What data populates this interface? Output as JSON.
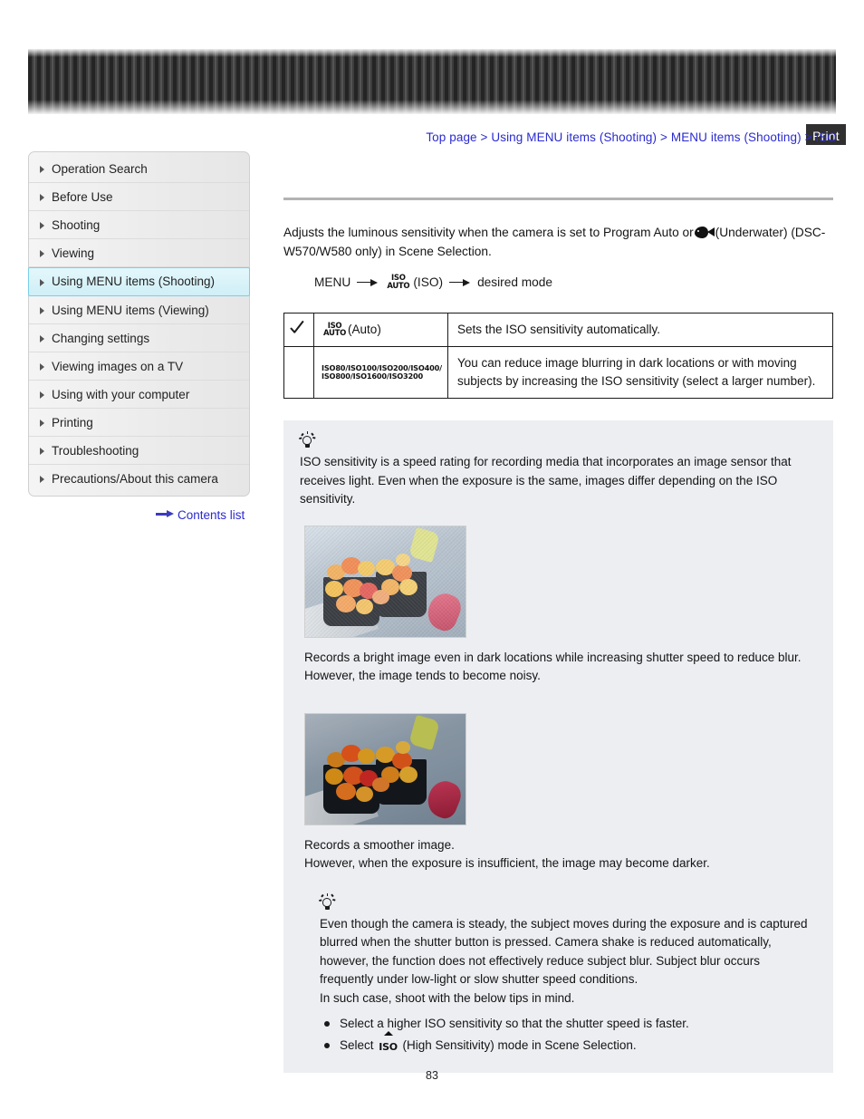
{
  "header": {
    "print_label": "Print"
  },
  "breadcrumb": {
    "items": [
      "Top page",
      "Using MENU items (Shooting)",
      "MENU items (Shooting)",
      "ISO"
    ],
    "separator": ">"
  },
  "sidebar": {
    "items": [
      {
        "label": "Operation Search",
        "active": false
      },
      {
        "label": "Before Use",
        "active": false
      },
      {
        "label": "Shooting",
        "active": false
      },
      {
        "label": "Viewing",
        "active": false
      },
      {
        "label": "Using MENU items (Shooting)",
        "active": true
      },
      {
        "label": "Using MENU items (Viewing)",
        "active": false
      },
      {
        "label": "Changing settings",
        "active": false
      },
      {
        "label": "Viewing images on a TV",
        "active": false
      },
      {
        "label": "Using with your computer",
        "active": false
      },
      {
        "label": "Printing",
        "active": false
      },
      {
        "label": "Troubleshooting",
        "active": false
      },
      {
        "label": "Precautions/About this camera",
        "active": false
      }
    ],
    "contents_link": "Contents list"
  },
  "main": {
    "intro_part1": "Adjusts the luminous sensitivity when the camera is set to Program Auto or",
    "intro_part2": "(Underwater) (DSC-W570/W580 only) in Scene Selection.",
    "menu_path": {
      "start": "MENU",
      "icon_top": "ISO",
      "icon_bottom": "AUTO",
      "middle": "(ISO)",
      "end": "desired mode"
    },
    "table": {
      "rows": [
        {
          "checked": true,
          "icon_top": "ISO",
          "icon_bottom": "AUTO",
          "option_label": "(Auto)",
          "description": "Sets the ISO sensitivity automatically."
        },
        {
          "checked": false,
          "iso_values_row1": [
            "80",
            "100",
            "200",
            "400"
          ],
          "iso_values_row2": [
            "800",
            "1600",
            "3200"
          ],
          "iso_prefix": "ISO",
          "description": "You can reduce image blurring in dark locations or with moving subjects by increasing the ISO sensitivity (select a larger number)."
        }
      ]
    },
    "tip1": {
      "icon": "lightbulb-icon",
      "text": "ISO sensitivity is a speed rating for recording media that incorporates an image sensor that receives light. Even when the exposure is the same, images differ depending on the ISO sensitivity."
    },
    "photo1": {
      "alt": "Bright flowers photo at high ISO",
      "caption_line1": "Records a bright image even in dark locations while increasing shutter speed to reduce blur.",
      "caption_line2": "However, the image tends to become noisy."
    },
    "photo2": {
      "alt": "Smoother flowers photo at low ISO",
      "caption_line1": "Records a smoother image.",
      "caption_line2": "However, when the exposure is insufficient, the image may become darker."
    },
    "tip2": {
      "icon": "lightbulb-icon",
      "paragraph": "Even though the camera is steady, the subject moves during the exposure and is captured blurred when the shutter button is pressed. Camera shake is reduced automatically, however, the function does not effectively reduce subject blur. Subject blur occurs frequently under low-light or slow shutter speed conditions.",
      "line2": "In such case, shoot with the below tips in mind.",
      "bullet1": "Select a higher ISO sensitivity so that the shutter speed is faster.",
      "bullet2_pre": "Select",
      "bullet2_icon": "ISO",
      "bullet2_post": "(High Sensitivity) mode in Scene Selection."
    }
  },
  "footer": {
    "page_number": "83"
  },
  "colors": {
    "link": "#2a2ad0",
    "tip_background": "#eceef2",
    "sidebar_active_border": "#79cfe6"
  }
}
